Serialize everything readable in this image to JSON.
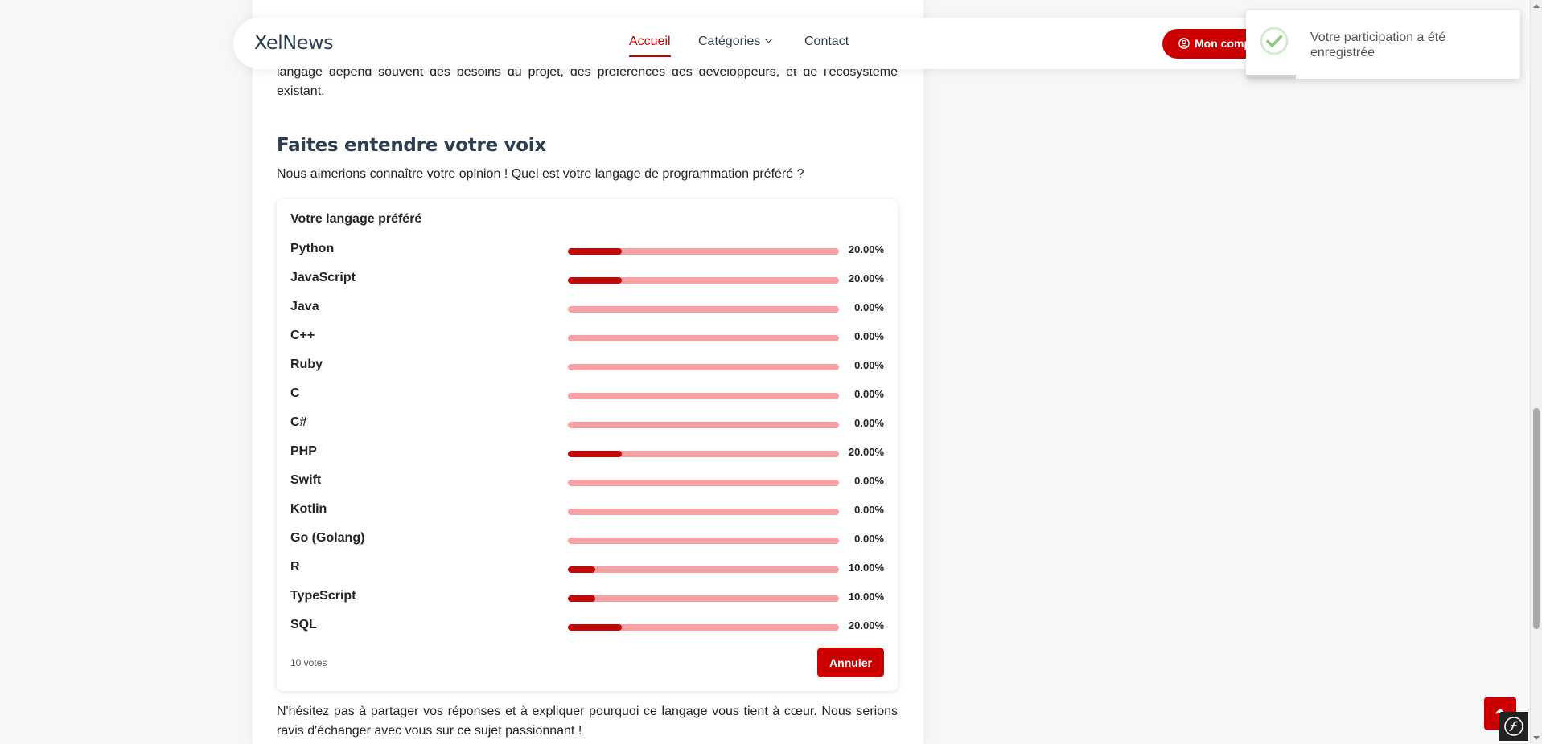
{
  "navbar": {
    "brand": "XelNews",
    "links": [
      {
        "label": "Accueil",
        "active": true
      },
      {
        "label": "Catégories"
      },
      {
        "label": "Contact"
      }
    ],
    "account_label": "Mon compte"
  },
  "article": {
    "paragraph_top": "langage dépend souvent des besoins du projet, des préférences des développeurs, et de l'écosystème existant.",
    "heading": "Faites entendre votre voix",
    "intro": "Nous aimerions connaître votre opinion ! Quel est votre langage de programmation préféré ?",
    "paragraph_bottom": "N'hésitez pas à partager vos réponses et à expliquer pourquoi ce langage vous tient à cœur. Nous serions ravis d'échanger avec vous sur ce sujet passionnant !"
  },
  "poll": {
    "title": "Votre langage préféré",
    "options": [
      {
        "label": "Python",
        "percent": "20.00%",
        "value": 20
      },
      {
        "label": "JavaScript",
        "percent": "20.00%",
        "value": 20
      },
      {
        "label": "Java",
        "percent": "0.00%",
        "value": 0
      },
      {
        "label": "C++",
        "percent": "0.00%",
        "value": 0
      },
      {
        "label": "Ruby",
        "percent": "0.00%",
        "value": 0
      },
      {
        "label": "C",
        "percent": "0.00%",
        "value": 0
      },
      {
        "label": "C#",
        "percent": "0.00%",
        "value": 0
      },
      {
        "label": "PHP",
        "percent": "20.00%",
        "value": 20
      },
      {
        "label": "Swift",
        "percent": "0.00%",
        "value": 0
      },
      {
        "label": "Kotlin",
        "percent": "0.00%",
        "value": 0
      },
      {
        "label": "Go (Golang)",
        "percent": "0.00%",
        "value": 0
      },
      {
        "label": "R",
        "percent": "10.00%",
        "value": 10
      },
      {
        "label": "TypeScript",
        "percent": "10.00%",
        "value": 10
      },
      {
        "label": "SQL",
        "percent": "20.00%",
        "value": 20
      }
    ],
    "votes": "10 votes",
    "cancel_label": "Annuler"
  },
  "toast": {
    "message": "Votre participation a été enregistrée"
  },
  "icons": {
    "toast": "check-circle-icon",
    "account": "user-circle-icon",
    "scroll_top": "arrow-up-icon",
    "debug": "symfony-icon"
  },
  "colors": {
    "accent": "#cc0000",
    "bar_fill": "#c60707",
    "bar_track": "#f8a0a3",
    "heading": "#2c3e50"
  }
}
